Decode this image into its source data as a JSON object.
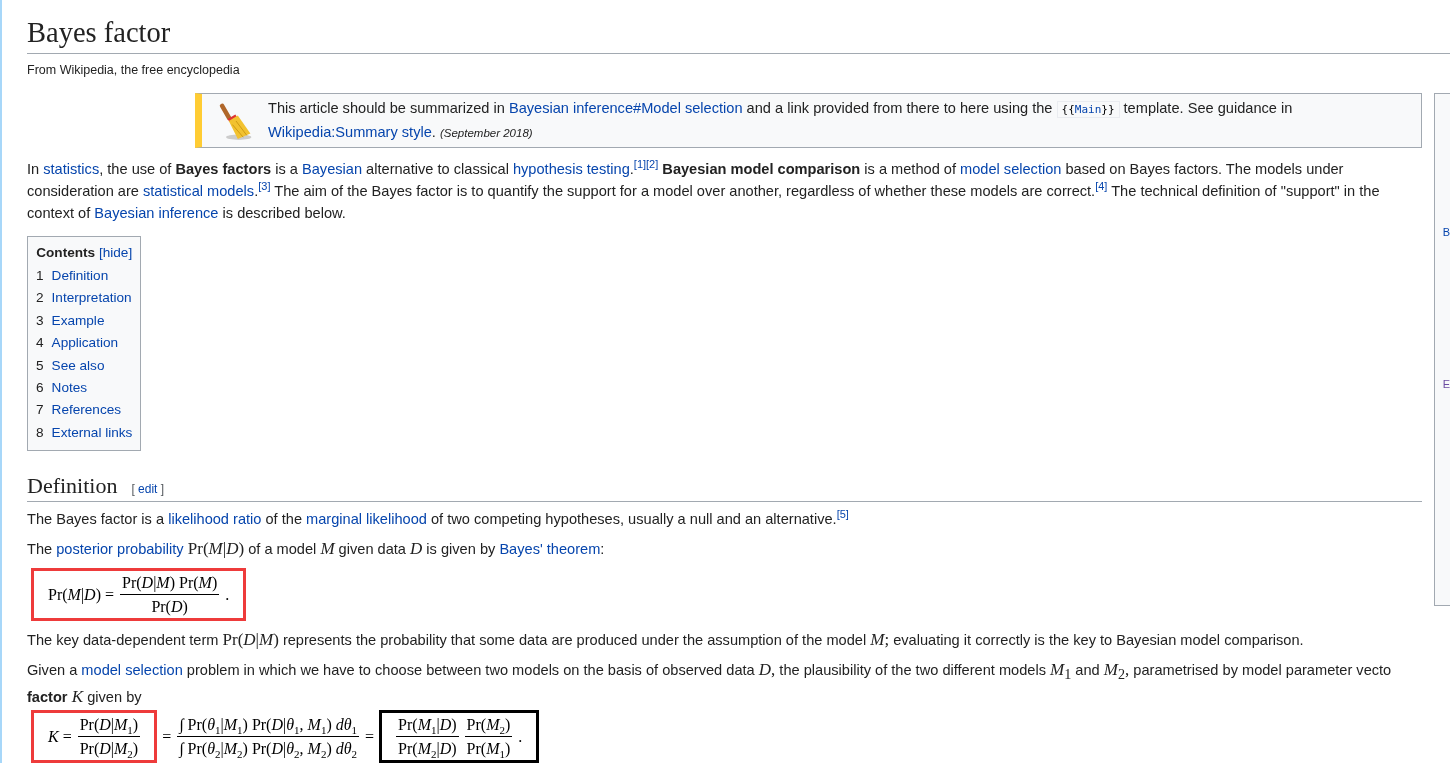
{
  "title": "Bayes factor",
  "tagline": "From Wikipedia, the free encyclopedia",
  "side_panel": {
    "letters": [
      "B",
      "E"
    ]
  },
  "notice": {
    "segments": [
      {
        "kind": "text",
        "text": "This article should be summarized in "
      },
      {
        "kind": "link",
        "text": "Bayesian inference#Model selection"
      },
      {
        "kind": "text",
        "text": " and a link provided from there to here using the "
      },
      {
        "kind": "code",
        "before": "{{",
        "text": "Main",
        "after": "}}"
      },
      {
        "kind": "text",
        "text": " template. See guidance in "
      },
      {
        "kind": "link",
        "text": "Wikipedia:Summary style"
      },
      {
        "kind": "text",
        "text": ". "
      },
      {
        "kind": "small",
        "text": "(September 2018)"
      }
    ]
  },
  "intro": [
    {
      "kind": "text",
      "text": "In "
    },
    {
      "kind": "link",
      "text": "statistics"
    },
    {
      "kind": "text",
      "text": ", the use of "
    },
    {
      "kind": "bold",
      "text": "Bayes factors"
    },
    {
      "kind": "text",
      "text": " is a "
    },
    {
      "kind": "link",
      "text": "Bayesian"
    },
    {
      "kind": "text",
      "text": " alternative to classical "
    },
    {
      "kind": "link",
      "text": "hypothesis testing"
    },
    {
      "kind": "text",
      "text": "."
    },
    {
      "kind": "ref",
      "text": "[1]"
    },
    {
      "kind": "ref",
      "text": "[2]"
    },
    {
      "kind": "bold",
      "text": " Bayesian model comparison"
    },
    {
      "kind": "text",
      "text": " is a method of "
    },
    {
      "kind": "link",
      "text": "model selection"
    },
    {
      "kind": "text",
      "text": " based on Bayes factors. The models under consideration are "
    },
    {
      "kind": "link",
      "text": "statistical models"
    },
    {
      "kind": "text",
      "text": "."
    },
    {
      "kind": "ref",
      "text": "[3]"
    },
    {
      "kind": "text",
      "text": " The aim of the Bayes factor is to quantify the support for a model over another, regardless of whether these models are correct."
    },
    {
      "kind": "ref",
      "text": "[4]"
    },
    {
      "kind": "text",
      "text": " The technical definition of \"support\" in the context of "
    },
    {
      "kind": "link",
      "text": "Bayesian inference"
    },
    {
      "kind": "text",
      "text": " is described below."
    }
  ],
  "contents": {
    "title": "Contents",
    "toggle": "[hide]",
    "items": [
      {
        "number": "1",
        "label": "Definition"
      },
      {
        "number": "2",
        "label": "Interpretation"
      },
      {
        "number": "3",
        "label": "Example"
      },
      {
        "number": "4",
        "label": "Application"
      },
      {
        "number": "5",
        "label": "See also"
      },
      {
        "number": "6",
        "label": "Notes"
      },
      {
        "number": "7",
        "label": "References"
      },
      {
        "number": "8",
        "label": "External links"
      }
    ]
  },
  "section": {
    "heading": "Definition",
    "edit": {
      "before": "[ ",
      "label": "edit",
      "after": " ]"
    },
    "blocks": [
      {
        "kind": "paragraph",
        "segments": [
          {
            "kind": "text",
            "text": "The Bayes factor is a "
          },
          {
            "kind": "link",
            "text": "likelihood ratio"
          },
          {
            "kind": "text",
            "text": " of the "
          },
          {
            "kind": "link",
            "text": "marginal likelihood"
          },
          {
            "kind": "text",
            "text": " of two competing hypotheses, usually a null and an alternative."
          },
          {
            "kind": "ref",
            "text": "[5]"
          }
        ]
      },
      {
        "kind": "paragraph",
        "segments": [
          {
            "kind": "text",
            "text": "The "
          },
          {
            "kind": "link",
            "text": "posterior probability"
          },
          {
            "kind": "math",
            "text": " Pr(*M*|*D*)"
          },
          {
            "kind": "text",
            "text": " of a model "
          },
          {
            "kind": "math",
            "text": "*M*"
          },
          {
            "kind": "text",
            "text": " given data "
          },
          {
            "kind": "math",
            "text": "*D*"
          },
          {
            "kind": "text",
            "text": " is given by "
          },
          {
            "kind": "link",
            "text": "Bayes' theorem"
          },
          {
            "kind": "text",
            "text": ":"
          }
        ]
      },
      {
        "kind": "equation",
        "groups": [
          {
            "color": "#ee3b3b",
            "parts": [
              {
                "kind": "text",
                "text": "Pr(*M*|*D*) ="
              },
              {
                "kind": "fraction",
                "numerator": "Pr(*D*|*M*) Pr(*M*)",
                "denominator": "Pr(*D*)"
              },
              {
                "kind": "text",
                "text": "."
              }
            ]
          }
        ]
      },
      {
        "kind": "paragraph",
        "segments": [
          {
            "kind": "text",
            "text": "The key data-dependent term "
          },
          {
            "kind": "math",
            "text": "Pr(*D*|*M*)"
          },
          {
            "kind": "text",
            "text": " represents the probability that some data are produced under the assumption of the model "
          },
          {
            "kind": "math",
            "text": "*M*;"
          },
          {
            "kind": "text",
            "text": " evaluating it correctly is the key to Bayesian model comparison."
          }
        ]
      },
      {
        "kind": "lines",
        "lines": [
          [
            {
              "kind": "text",
              "text": "Given a "
            },
            {
              "kind": "link",
              "text": "model selection"
            },
            {
              "kind": "text",
              "text": " problem in which we have to choose between two models on the basis of observed data "
            },
            {
              "kind": "math",
              "text": "*D*,"
            },
            {
              "kind": "text",
              "text": " the plausibility of the two different models "
            },
            {
              "kind": "math",
              "text": "*M*$_{1}$"
            },
            {
              "kind": "text",
              "text": " and "
            },
            {
              "kind": "math",
              "text": "*M*$_{2}$,"
            },
            {
              "kind": "text",
              "text": " parametrised by model parameter vecto"
            }
          ],
          [
            {
              "kind": "bold",
              "text": "factor"
            },
            {
              "kind": "math",
              "text": " *K*"
            },
            {
              "kind": "text",
              "text": " given by"
            }
          ]
        ]
      },
      {
        "kind": "equation",
        "groups": [
          {
            "color": "#ee3b3b",
            "parts": [
              {
                "kind": "text",
                "text": "*K* ="
              },
              {
                "kind": "fraction",
                "numerator": "Pr(*D*|*M*$_{1}$)",
                "denominator": "Pr(*D*|*M*$_{2}$)"
              }
            ]
          },
          {
            "parts": [
              {
                "kind": "text",
                "text": "="
              },
              {
                "kind": "fraction",
                "numerator": "∫ Pr(*θ*$_{1}$|*M*$_{1}$) Pr(*D*|*θ*$_{1}$, *M*$_{1}$) *dθ*$_{1}$",
                "denominator": "∫ Pr(*θ*$_{2}$|*M*$_{2}$) Pr(*D*|*θ*$_{2}$, *M*$_{2}$) *dθ*$_{2}$"
              },
              {
                "kind": "text",
                "text": "="
              }
            ]
          },
          {
            "color": "#000000",
            "parts": [
              {
                "kind": "fraction",
                "numerator": "Pr(*M*$_{1}$|*D*)",
                "denominator": "Pr(*M*$_{2}$|*D*)"
              },
              {
                "kind": "fraction",
                "numerator": "Pr(*M*$_{2}$)",
                "denominator": "Pr(*M*$_{1}$)"
              },
              {
                "kind": "text",
                "text": "."
              }
            ]
          }
        ]
      }
    ]
  }
}
